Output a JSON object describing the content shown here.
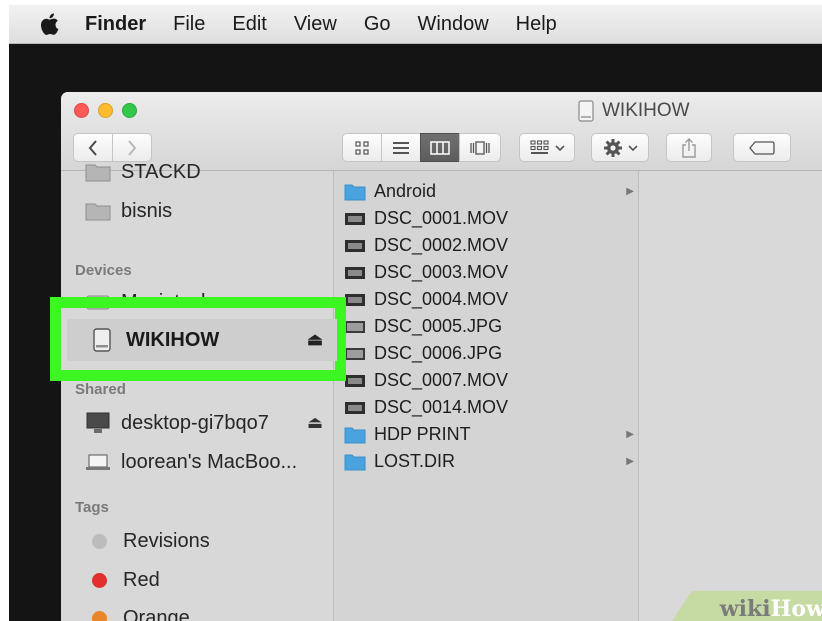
{
  "menubar": {
    "items": [
      "Finder",
      "File",
      "Edit",
      "View",
      "Go",
      "Window",
      "Help"
    ]
  },
  "window": {
    "title": "WIKIHOW"
  },
  "sidebar": {
    "favorites": [
      {
        "label": "STACKD"
      },
      {
        "label": "bisnis"
      }
    ],
    "devices_heading": "Devices",
    "devices": [
      {
        "label": "Macintosh"
      },
      {
        "label": "WIKIHOW",
        "icon": "drive-icon",
        "eject": "⏏"
      }
    ],
    "shared_heading": "Shared",
    "shared": [
      {
        "label": "desktop-gi7bqo7",
        "eject": "⏏"
      },
      {
        "label": "loorean's MacBoo..."
      }
    ],
    "tags_heading": "Tags",
    "tags": [
      {
        "label": "Revisions",
        "color": "#bcbcbc"
      },
      {
        "label": "Red",
        "color": "#e3302f"
      },
      {
        "label": "Orange",
        "color": "#e8872a"
      }
    ]
  },
  "files": [
    {
      "name": "Android",
      "type": "folder",
      "has_children": true
    },
    {
      "name": "DSC_0001.MOV",
      "type": "video"
    },
    {
      "name": "DSC_0002.MOV",
      "type": "video"
    },
    {
      "name": "DSC_0003.MOV",
      "type": "video"
    },
    {
      "name": "DSC_0004.MOV",
      "type": "video"
    },
    {
      "name": "DSC_0005.JPG",
      "type": "image"
    },
    {
      "name": "DSC_0006.JPG",
      "type": "image"
    },
    {
      "name": "DSC_0007.MOV",
      "type": "video"
    },
    {
      "name": "DSC_0014.MOV",
      "type": "video"
    },
    {
      "name": "HDP PRINT",
      "type": "folder",
      "has_children": true
    },
    {
      "name": "LOST.DIR",
      "type": "folder",
      "has_children": true
    }
  ],
  "highlight_color": "#3cf523",
  "watermark": {
    "prefix": "wiki",
    "suffix": "How",
    "prefix_color": "#7b7b7b",
    "suffix_color": "#ffffff"
  }
}
